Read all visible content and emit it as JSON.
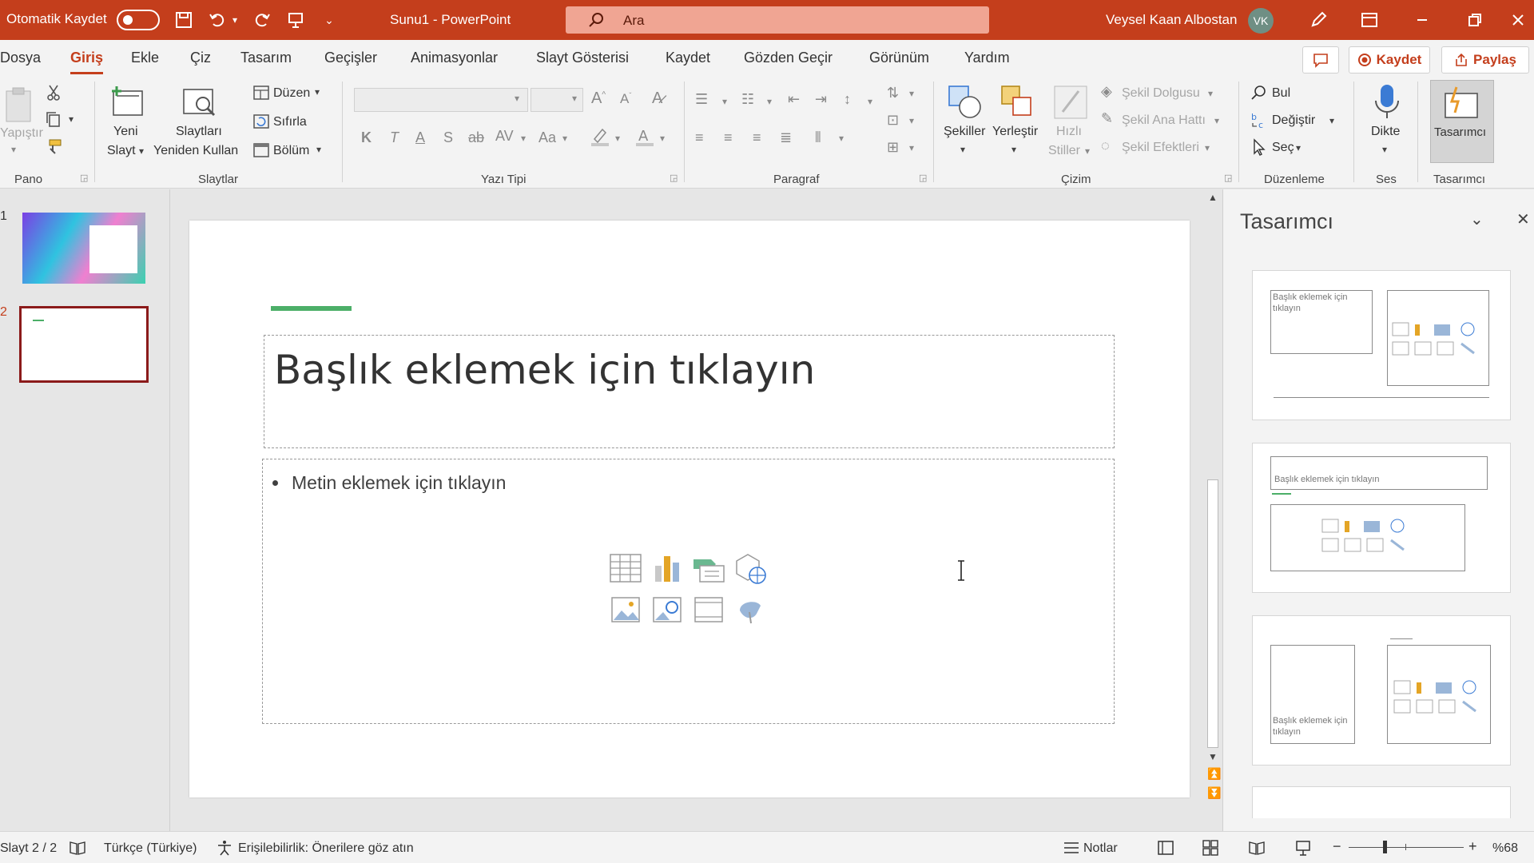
{
  "titlebar": {
    "autosave_label": "Otomatik Kaydet",
    "doc_title": "Sunu1  -  PowerPoint",
    "search_placeholder": "Ara",
    "user_name": "Veysel Kaan Albostan",
    "user_initials": "VK"
  },
  "tabs": [
    "Dosya",
    "Giriş",
    "Ekle",
    "Çiz",
    "Tasarım",
    "Geçişler",
    "Animasyonlar",
    "Slayt Gösterisi",
    "Kaydet",
    "Gözden Geçir",
    "Görünüm",
    "Yardım"
  ],
  "actions": {
    "save": "Kaydet",
    "share": "Paylaş"
  },
  "ribbon": {
    "pano": {
      "label": "Pano",
      "paste": "Yapıştır"
    },
    "slaytlar": {
      "label": "Slaytlar",
      "new_slide_1": "Yeni",
      "new_slide_2": "Slayt",
      "reuse_1": "Slaytları",
      "reuse_2": "Yeniden Kullan",
      "layout": "Düzen",
      "reset": "Sıfırla",
      "section": "Bölüm"
    },
    "yazi_tipi": {
      "label": "Yazı Tipi",
      "bold": "K",
      "italic": "T",
      "underline": "A",
      "shadow": "S",
      "strike": "ab",
      "spacing": "AV",
      "case": "Aa"
    },
    "paragraf": {
      "label": "Paragraf"
    },
    "cizim": {
      "label": "Çizim",
      "shapes": "Şekiller",
      "arrange": "Yerleştir",
      "quick_1": "Hızlı",
      "quick_2": "Stiller",
      "fill": "Şekil Dolgusu",
      "outline": "Şekil Ana Hattı",
      "effects": "Şekil Efektleri"
    },
    "duzenleme": {
      "label": "Düzenleme",
      "find": "Bul",
      "replace": "Değiştir",
      "select": "Seç"
    },
    "ses": {
      "label": "Ses",
      "dictate": "Dikte"
    },
    "tasarimci": {
      "label": "Tasarımcı",
      "button": "Tasarımcı"
    }
  },
  "slides_panel": {
    "numbers": [
      "1",
      "2"
    ]
  },
  "slide": {
    "title_placeholder": "Başlık eklemek için tıklayın",
    "body_placeholder": "Metin eklemek için tıklayın"
  },
  "designer": {
    "title": "Tasarımcı",
    "card_title_1": "Başlık eklemek için tıklayın",
    "card_title_3": "Başlık eklemek için tıklayın"
  },
  "statusbar": {
    "slide_count": "Slayt 2 / 2",
    "language": "Türkçe (Türkiye)",
    "accessibility": "Erişilebilirlik: Önerilere göz atın",
    "notes": "Notlar",
    "zoom": "%68"
  },
  "colors": {
    "brand": "#c43e1c",
    "accent_line": "#4caf68"
  }
}
